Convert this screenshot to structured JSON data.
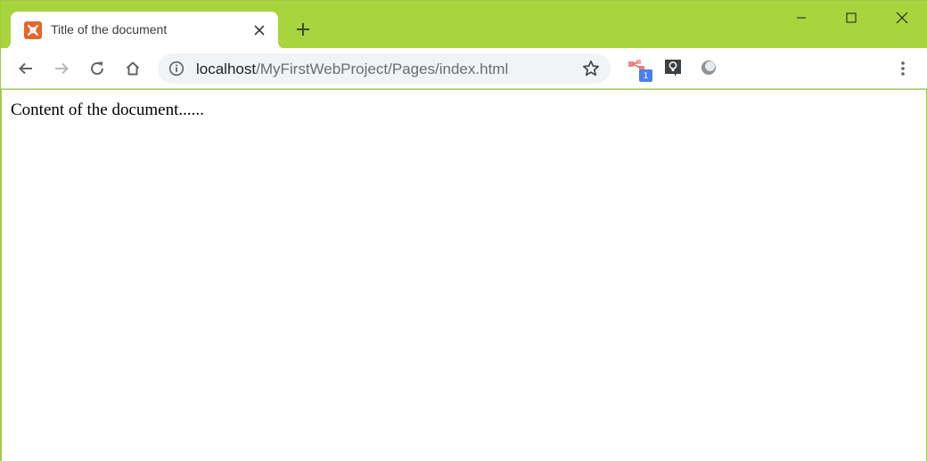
{
  "tab": {
    "title": "Title of the document",
    "favicon": "xampp-icon"
  },
  "address_bar": {
    "host": "localhost",
    "path": "/MyFirstWebProject/Pages/index.html"
  },
  "extensions": [
    {
      "icon": "extension-red-icon",
      "badge": "1"
    },
    {
      "icon": "extension-bulb-icon"
    },
    {
      "icon": "extension-circle-icon"
    }
  ],
  "page": {
    "content": "Content of the document......"
  },
  "colors": {
    "frame": "#a8d43e",
    "tab": "#ffffff",
    "omnibox": "#f1f3f4",
    "favicon": "#e7652a",
    "badge": "#4a7ff0"
  }
}
